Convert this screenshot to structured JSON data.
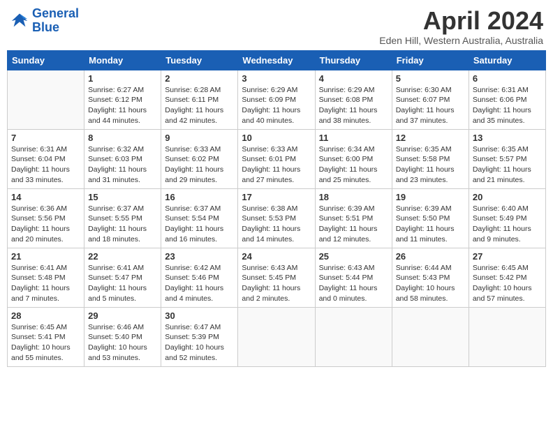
{
  "header": {
    "logo_line1": "General",
    "logo_line2": "Blue",
    "month": "April 2024",
    "location": "Eden Hill, Western Australia, Australia"
  },
  "days_of_week": [
    "Sunday",
    "Monday",
    "Tuesday",
    "Wednesday",
    "Thursday",
    "Friday",
    "Saturday"
  ],
  "weeks": [
    [
      {
        "day": "",
        "info": ""
      },
      {
        "day": "1",
        "info": "Sunrise: 6:27 AM\nSunset: 6:12 PM\nDaylight: 11 hours\nand 44 minutes."
      },
      {
        "day": "2",
        "info": "Sunrise: 6:28 AM\nSunset: 6:11 PM\nDaylight: 11 hours\nand 42 minutes."
      },
      {
        "day": "3",
        "info": "Sunrise: 6:29 AM\nSunset: 6:09 PM\nDaylight: 11 hours\nand 40 minutes."
      },
      {
        "day": "4",
        "info": "Sunrise: 6:29 AM\nSunset: 6:08 PM\nDaylight: 11 hours\nand 38 minutes."
      },
      {
        "day": "5",
        "info": "Sunrise: 6:30 AM\nSunset: 6:07 PM\nDaylight: 11 hours\nand 37 minutes."
      },
      {
        "day": "6",
        "info": "Sunrise: 6:31 AM\nSunset: 6:06 PM\nDaylight: 11 hours\nand 35 minutes."
      }
    ],
    [
      {
        "day": "7",
        "info": "Sunrise: 6:31 AM\nSunset: 6:04 PM\nDaylight: 11 hours\nand 33 minutes."
      },
      {
        "day": "8",
        "info": "Sunrise: 6:32 AM\nSunset: 6:03 PM\nDaylight: 11 hours\nand 31 minutes."
      },
      {
        "day": "9",
        "info": "Sunrise: 6:33 AM\nSunset: 6:02 PM\nDaylight: 11 hours\nand 29 minutes."
      },
      {
        "day": "10",
        "info": "Sunrise: 6:33 AM\nSunset: 6:01 PM\nDaylight: 11 hours\nand 27 minutes."
      },
      {
        "day": "11",
        "info": "Sunrise: 6:34 AM\nSunset: 6:00 PM\nDaylight: 11 hours\nand 25 minutes."
      },
      {
        "day": "12",
        "info": "Sunrise: 6:35 AM\nSunset: 5:58 PM\nDaylight: 11 hours\nand 23 minutes."
      },
      {
        "day": "13",
        "info": "Sunrise: 6:35 AM\nSunset: 5:57 PM\nDaylight: 11 hours\nand 21 minutes."
      }
    ],
    [
      {
        "day": "14",
        "info": "Sunrise: 6:36 AM\nSunset: 5:56 PM\nDaylight: 11 hours\nand 20 minutes."
      },
      {
        "day": "15",
        "info": "Sunrise: 6:37 AM\nSunset: 5:55 PM\nDaylight: 11 hours\nand 18 minutes."
      },
      {
        "day": "16",
        "info": "Sunrise: 6:37 AM\nSunset: 5:54 PM\nDaylight: 11 hours\nand 16 minutes."
      },
      {
        "day": "17",
        "info": "Sunrise: 6:38 AM\nSunset: 5:53 PM\nDaylight: 11 hours\nand 14 minutes."
      },
      {
        "day": "18",
        "info": "Sunrise: 6:39 AM\nSunset: 5:51 PM\nDaylight: 11 hours\nand 12 minutes."
      },
      {
        "day": "19",
        "info": "Sunrise: 6:39 AM\nSunset: 5:50 PM\nDaylight: 11 hours\nand 11 minutes."
      },
      {
        "day": "20",
        "info": "Sunrise: 6:40 AM\nSunset: 5:49 PM\nDaylight: 11 hours\nand 9 minutes."
      }
    ],
    [
      {
        "day": "21",
        "info": "Sunrise: 6:41 AM\nSunset: 5:48 PM\nDaylight: 11 hours\nand 7 minutes."
      },
      {
        "day": "22",
        "info": "Sunrise: 6:41 AM\nSunset: 5:47 PM\nDaylight: 11 hours\nand 5 minutes."
      },
      {
        "day": "23",
        "info": "Sunrise: 6:42 AM\nSunset: 5:46 PM\nDaylight: 11 hours\nand 4 minutes."
      },
      {
        "day": "24",
        "info": "Sunrise: 6:43 AM\nSunset: 5:45 PM\nDaylight: 11 hours\nand 2 minutes."
      },
      {
        "day": "25",
        "info": "Sunrise: 6:43 AM\nSunset: 5:44 PM\nDaylight: 11 hours\nand 0 minutes."
      },
      {
        "day": "26",
        "info": "Sunrise: 6:44 AM\nSunset: 5:43 PM\nDaylight: 10 hours\nand 58 minutes."
      },
      {
        "day": "27",
        "info": "Sunrise: 6:45 AM\nSunset: 5:42 PM\nDaylight: 10 hours\nand 57 minutes."
      }
    ],
    [
      {
        "day": "28",
        "info": "Sunrise: 6:45 AM\nSunset: 5:41 PM\nDaylight: 10 hours\nand 55 minutes."
      },
      {
        "day": "29",
        "info": "Sunrise: 6:46 AM\nSunset: 5:40 PM\nDaylight: 10 hours\nand 53 minutes."
      },
      {
        "day": "30",
        "info": "Sunrise: 6:47 AM\nSunset: 5:39 PM\nDaylight: 10 hours\nand 52 minutes."
      },
      {
        "day": "",
        "info": ""
      },
      {
        "day": "",
        "info": ""
      },
      {
        "day": "",
        "info": ""
      },
      {
        "day": "",
        "info": ""
      }
    ]
  ]
}
